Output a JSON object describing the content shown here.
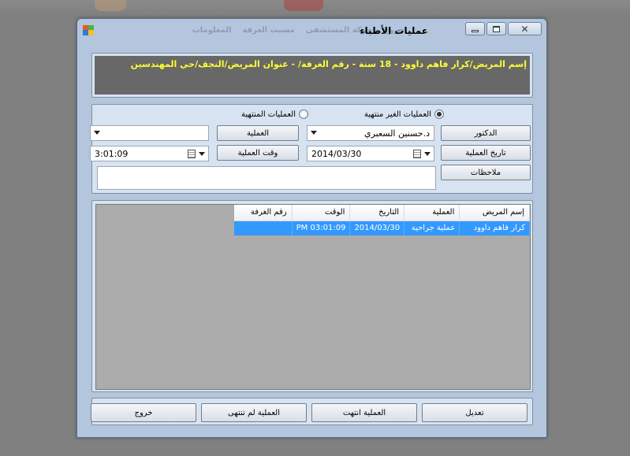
{
  "window": {
    "title": "عمليات الأطباء",
    "faded_menu": [
      "خروج",
      "حركة المستشفى",
      "مسيت الغرفة",
      "المعلومات"
    ]
  },
  "patient_header": "إسم المريض/كرار فاهم داوود - 18 سنة - رقم الغرفة/ - عنوان المريض/النجف/حي المهندسين",
  "filter": {
    "unfinished_label": "العمليات الغير منتهية",
    "unfinished_checked": true,
    "finished_label": "العمليات المنتهية",
    "finished_checked": false
  },
  "form": {
    "doctor_button": "الدكتور",
    "doctor_value": "د.حسنين السعبري",
    "operation_date_button": "تاريخ العملية",
    "operation_date_value": "2014/03/30",
    "notes_button": "ملاحظات",
    "operation_button": "العملية",
    "operation_value": "",
    "operation_time_button": "وقت العملية",
    "operation_time_value": "3:01:09"
  },
  "grid": {
    "columns": [
      "إسم المريض",
      "العملية",
      "التاريخ",
      "الوقت",
      "رقم الغرفة"
    ],
    "rows": [
      [
        "كرار فاهم داوود",
        "عملية جراحية",
        "2014/03/30",
        "03:01:09 PM",
        ""
      ]
    ]
  },
  "actions": {
    "edit": "تعديل",
    "operation_finished": "العملية انتهت",
    "operation_not_finished": "العملية لم تنتهى",
    "exit": "خروج"
  },
  "colors": {
    "window_bg": "#b3c6dd",
    "panel_bg": "#d7e3f1",
    "header_bg": "#686868",
    "header_text": "#ffff33",
    "selection": "#3399ff",
    "grid_bg": "#ababab"
  }
}
